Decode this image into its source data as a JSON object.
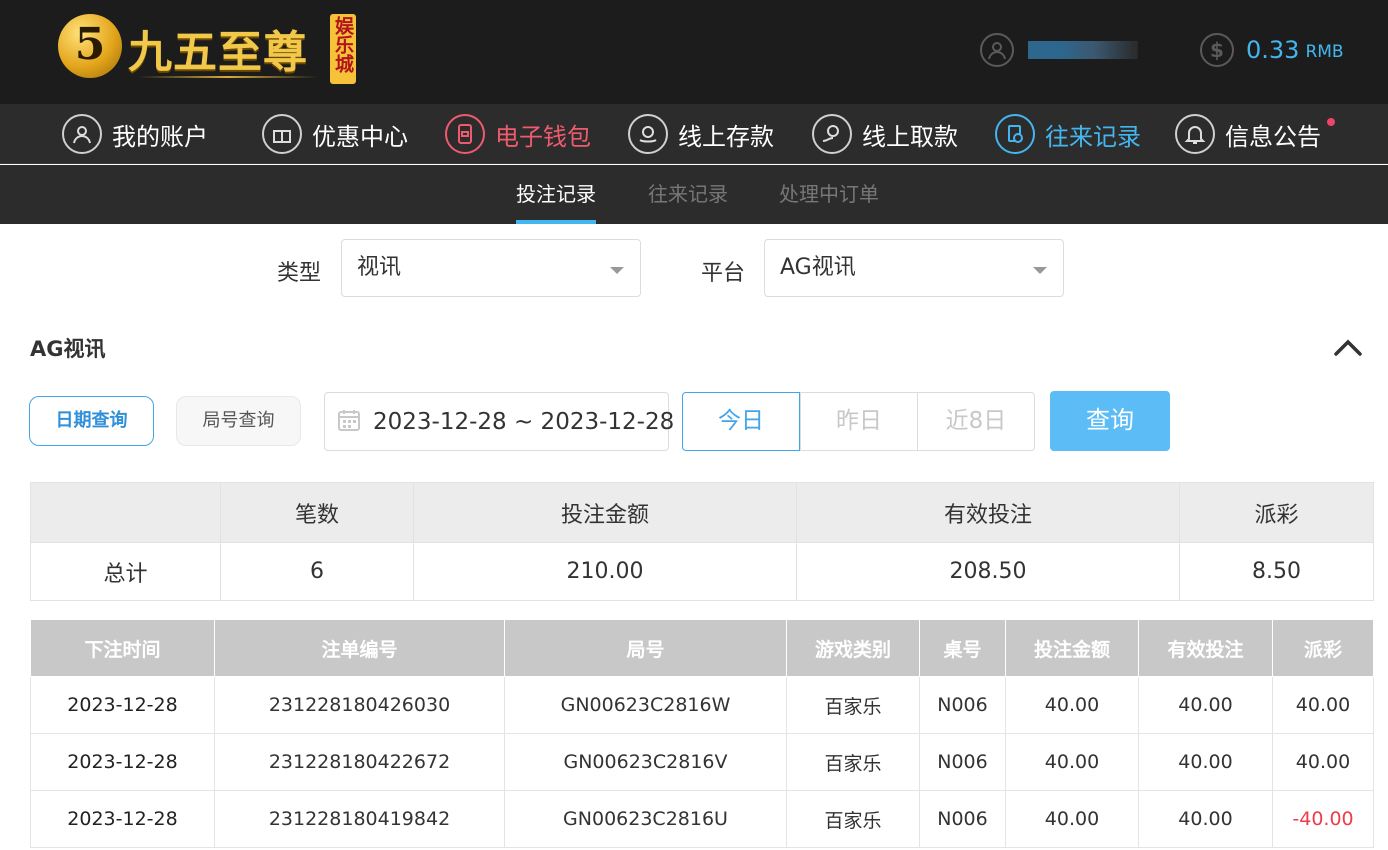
{
  "header": {
    "logo_number": "5",
    "logo_text": "九五至尊",
    "logo_badge": "娱乐城",
    "balance_value": "0.33",
    "balance_unit": "RMB"
  },
  "nav": {
    "items": [
      {
        "label": "我的账户"
      },
      {
        "label": "优惠中心"
      },
      {
        "label": "电子钱包"
      },
      {
        "label": "线上存款"
      },
      {
        "label": "线上取款"
      },
      {
        "label": "往来记录"
      },
      {
        "label": "信息公告"
      }
    ]
  },
  "subnav": {
    "tabs": [
      {
        "label": "投注记录"
      },
      {
        "label": "往来记录"
      },
      {
        "label": "处理中订单"
      }
    ]
  },
  "filters": {
    "type_label": "类型",
    "type_value": "视讯",
    "platform_label": "平台",
    "platform_value": "AG视讯"
  },
  "section": {
    "title": "AG视讯"
  },
  "query": {
    "mode_date": "日期查询",
    "mode_round": "局号查询",
    "date_range": "2023-12-28 ~ 2023-12-28",
    "today": "今日",
    "yesterday": "昨日",
    "last8": "近8日",
    "submit": "查询"
  },
  "summary": {
    "headers": [
      "",
      "笔数",
      "投注金额",
      "有效投注",
      "派彩"
    ],
    "row": [
      "总计",
      "6",
      "210.00",
      "208.50",
      "8.50"
    ]
  },
  "records": {
    "headers": [
      "下注时间",
      "注单编号",
      "局号",
      "游戏类别",
      "桌号",
      "投注金额",
      "有效投注",
      "派彩"
    ],
    "rows": [
      [
        "2023-12-28",
        "231228180426030",
        "GN00623C2816W",
        "百家乐",
        "N006",
        "40.00",
        "40.00",
        "40.00"
      ],
      [
        "2023-12-28",
        "231228180422672",
        "GN00623C2816V",
        "百家乐",
        "N006",
        "40.00",
        "40.00",
        "40.00"
      ],
      [
        "2023-12-28",
        "231228180419842",
        "GN00623C2816U",
        "百家乐",
        "N006",
        "40.00",
        "40.00",
        "-40.00"
      ]
    ]
  },
  "colors": {
    "accent": "#43b6ef",
    "wallet": "#ef5b6e",
    "negative": "#ee3c4a"
  }
}
